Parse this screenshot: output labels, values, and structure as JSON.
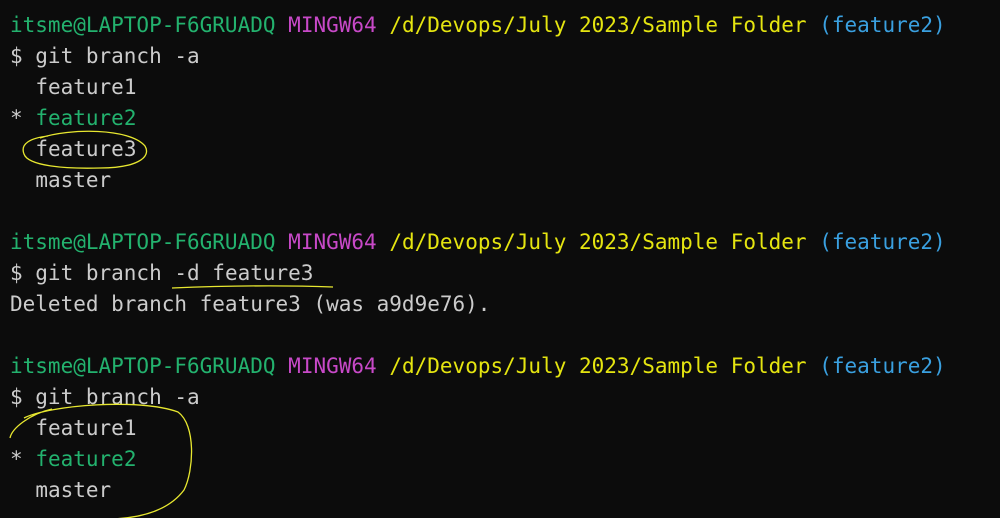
{
  "prompt": {
    "user_host": "itsme@LAPTOP-F6GRUADQ",
    "system": "MINGW64",
    "path": "/d/Devops/July 2023/Sample Folder",
    "branch": "(feature2)"
  },
  "blocks": [
    {
      "command": "$ git branch -a",
      "output": [
        {
          "marker": " ",
          "text": "feature1",
          "current": false
        },
        {
          "marker": "*",
          "text": "feature2",
          "current": true
        },
        {
          "marker": " ",
          "text": "feature3",
          "current": false
        },
        {
          "marker": " ",
          "text": "master",
          "current": false
        }
      ]
    },
    {
      "command_prefix": "$ git branch",
      "command_args": "-d feature3",
      "result": "Deleted branch feature3 (was a9d9e76)."
    },
    {
      "command": "$ git branch -a",
      "output": [
        {
          "marker": " ",
          "text": "feature1",
          "current": false
        },
        {
          "marker": "*",
          "text": "feature2",
          "current": true
        },
        {
          "marker": " ",
          "text": "master",
          "current": false
        }
      ]
    }
  ],
  "colors": {
    "background": "#0c0c0c",
    "user_host": "#23b26e",
    "system": "#c849c8",
    "path": "#e5e510",
    "branch": "#3aa0e0",
    "text": "#cccccc",
    "annotation": "#e8e830"
  }
}
